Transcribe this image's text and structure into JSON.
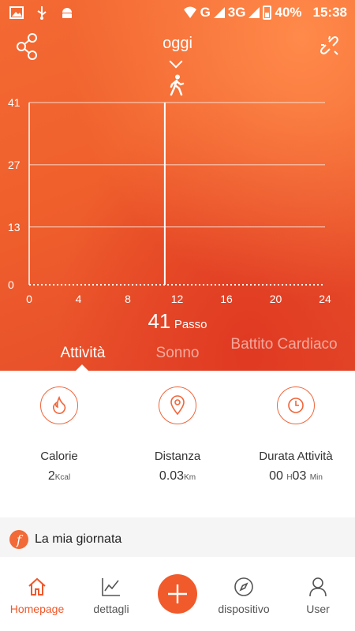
{
  "status_bar": {
    "network_g": "G",
    "network_3g": "3G",
    "battery": "40%",
    "time": "15:38"
  },
  "header": {
    "date_label": "oggi",
    "share_icon": "share-icon",
    "unlink_icon": "unlink-icon",
    "activity_icon": "walking-icon"
  },
  "chart_data": {
    "type": "bar",
    "x_ticks": [
      "0",
      "4",
      "8",
      "12",
      "16",
      "20",
      "24"
    ],
    "y_ticks": [
      "0",
      "13",
      "27",
      "41"
    ],
    "xlim": [
      0,
      24
    ],
    "ylim": [
      0,
      41
    ],
    "cursor_x": 11,
    "grid": true
  },
  "summary": {
    "steps": "41",
    "steps_unit": "Passo"
  },
  "tabs": [
    {
      "label": "Attività"
    },
    {
      "label": "Sonno"
    },
    {
      "label": "Battito Cardiaco"
    }
  ],
  "stats": [
    {
      "label": "Calorie",
      "value": "2",
      "unit": "Kcal",
      "icon": "flame-icon"
    },
    {
      "label": "Distanza",
      "value": "0.03",
      "unit": "Km",
      "icon": "location-pin-icon"
    },
    {
      "label": "Durata Attività",
      "hours": "00",
      "hours_unit": "H",
      "minutes": "03",
      "minutes_unit": "Min",
      "icon": "clock-icon"
    }
  ],
  "my_day": {
    "badge": "f",
    "label": "La mia giornata"
  },
  "nav": [
    {
      "label": "Homepage",
      "icon": "home-icon"
    },
    {
      "label": "dettagli",
      "icon": "chart-line-icon"
    },
    {
      "label": "",
      "icon": "plus-icon"
    },
    {
      "label": "dispositivo",
      "icon": "compass-icon"
    },
    {
      "label": "User",
      "icon": "user-icon"
    }
  ],
  "colors": {
    "accent": "#f15a2b",
    "hero_top": "#f46a33",
    "hero_bottom": "#e4482a"
  }
}
